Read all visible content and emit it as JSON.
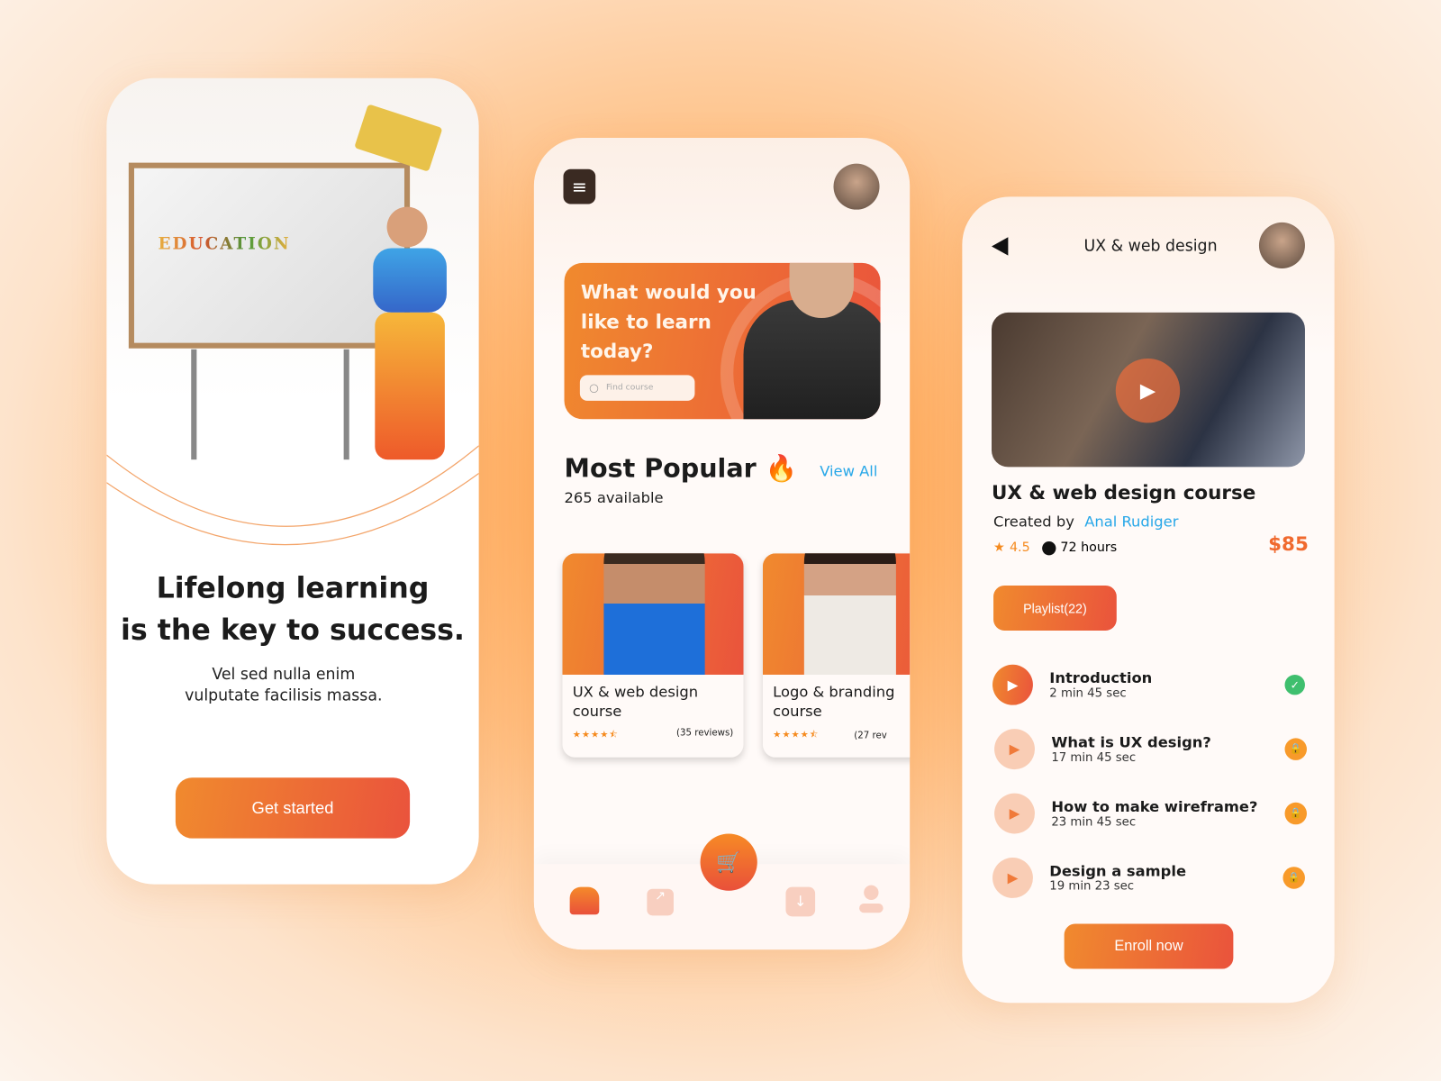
{
  "colors": {
    "accent": "#f0782e",
    "link": "#27a7e8",
    "price": "#f0692e"
  },
  "onboarding": {
    "board_text": "EDUCATION",
    "title_line1": "Lifelong learning",
    "title_line2": "is the key to success.",
    "subtitle_line1": "Vel sed nulla enim",
    "subtitle_line2": "vulputate facilisis massa.",
    "cta": "Get started"
  },
  "home": {
    "menu_icon": "menu-icon",
    "hero": {
      "line1": "What would you",
      "line2": "like to learn",
      "line3": "today?",
      "search_placeholder": "Find course"
    },
    "section_title": "Most Popular",
    "section_icon": "fire-icon",
    "view_all": "View All",
    "available": "265 available",
    "courses": [
      {
        "title_line1": "UX & web design",
        "title_line2": "course",
        "rating": 4.5,
        "reviews": "(35 reviews)"
      },
      {
        "title_line1": "Logo & branding",
        "title_line2": "course",
        "rating": 4.5,
        "reviews": "(27 rev"
      }
    ],
    "nav": [
      "home-icon",
      "chart-icon",
      "cart-icon",
      "download-icon",
      "profile-icon"
    ]
  },
  "detail": {
    "header_title": "UX & web design",
    "course_title": "UX & web design course",
    "created_by_label": "Created by",
    "author": "Anal Rudiger",
    "rating": "4.5",
    "duration": "72 hours",
    "price": "$85",
    "playlist_button": "Playlist(22)",
    "lessons": [
      {
        "title": "Introduction",
        "duration": "2 min 45 sec",
        "status": "completed"
      },
      {
        "title": "What is UX design?",
        "duration": "17 min 45 sec",
        "status": "locked"
      },
      {
        "title": "How to make wireframe?",
        "duration": "23 min 45 sec",
        "status": "locked"
      },
      {
        "title": "Design a sample",
        "duration": "19 min 23 sec",
        "status": "locked"
      }
    ],
    "enroll_button": "Enroll now"
  }
}
